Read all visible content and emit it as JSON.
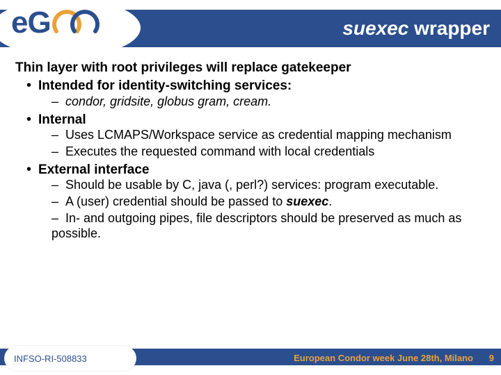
{
  "header": {
    "title_em": "suexec",
    "title_rest": " wrapper",
    "logo_name": "egee-logo"
  },
  "content": {
    "lead": "Thin layer with root privileges will replace gatekeeper",
    "b1": {
      "label": "Intended for identity-switching services:",
      "sub": [
        "condor, gridsite, globus gram, cream."
      ]
    },
    "b2": {
      "label": "Internal",
      "sub_a": "Uses LCMAPS/Workspace service as credential mapping mechanism",
      "sub_b": "Executes the requested command with local credentials"
    },
    "b3": {
      "label": "External interface",
      "sub_a": "Should be usable by C, java (, perl?) services: program executable.",
      "sub_b_pre": "A (user) credential should be passed to ",
      "sub_b_em": "suexec",
      "sub_b_post": ".",
      "sub_c": "In- and outgoing pipes, file descriptors should be preserved as much as possible."
    }
  },
  "footer": {
    "left": "INFSO-RI-508833",
    "right": "European Condor week June 28th, Milano",
    "page": "9"
  }
}
